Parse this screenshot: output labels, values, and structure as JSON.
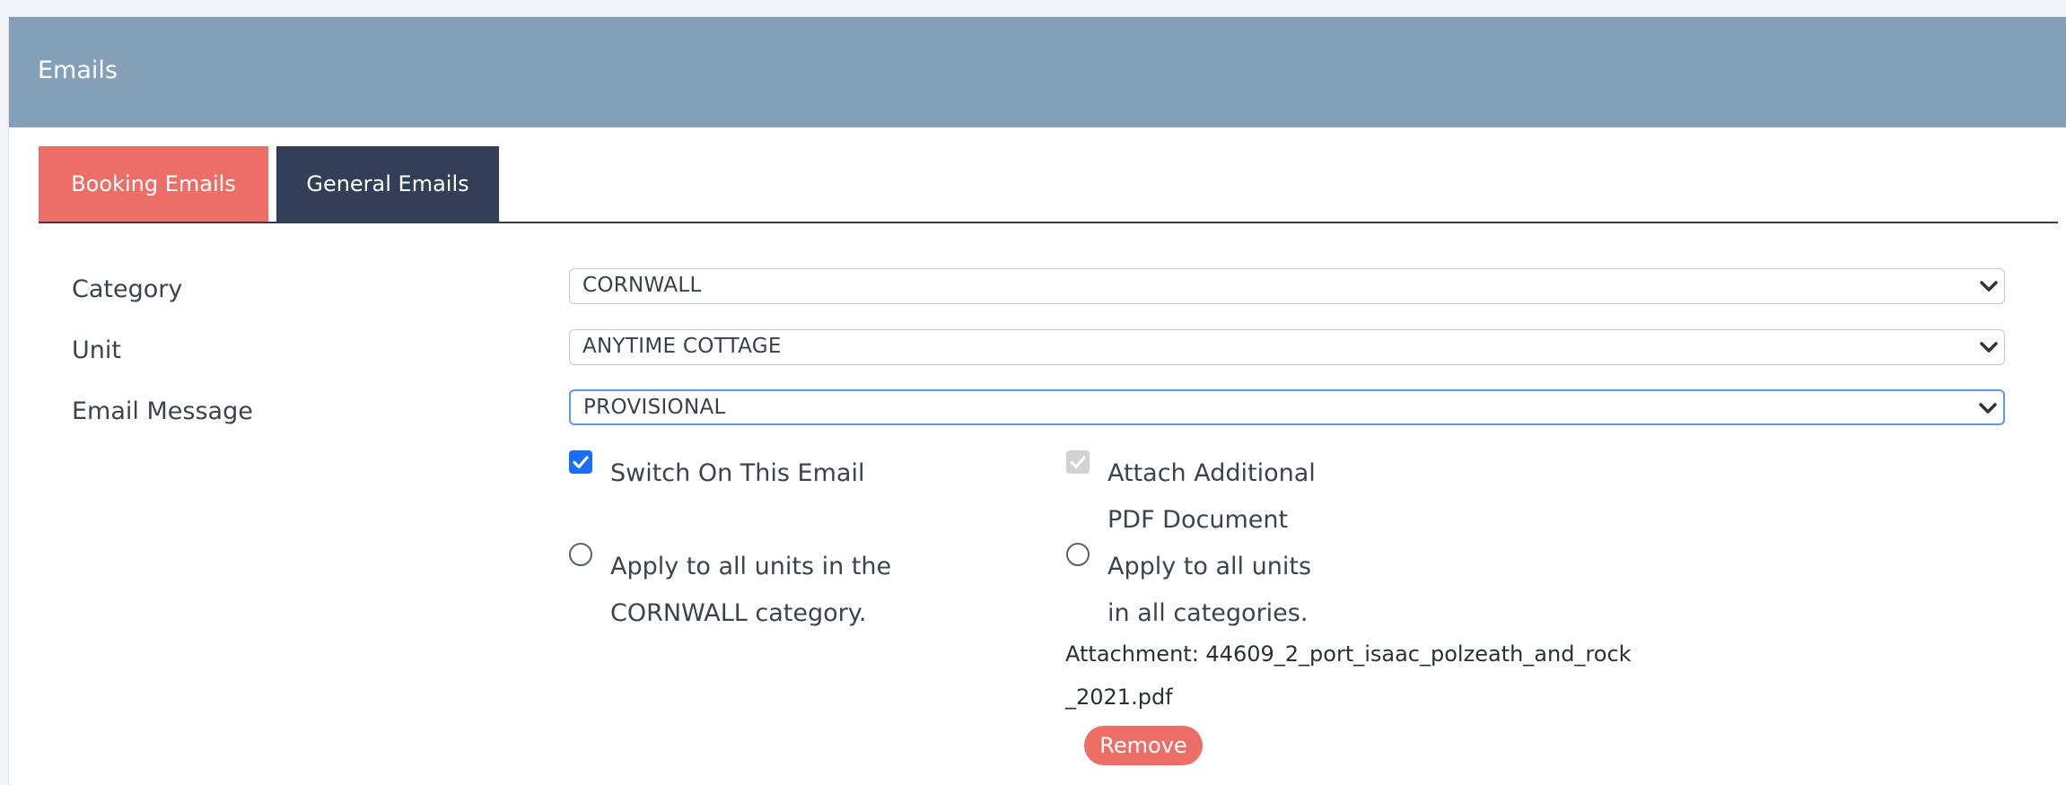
{
  "panel": {
    "title": "Emails"
  },
  "tabs": [
    {
      "label": "Booking Emails",
      "color": "#ec6e66"
    },
    {
      "label": "General Emails",
      "color": "#333f58"
    }
  ],
  "form": {
    "category": {
      "label": "Category",
      "value": "CORNWALL"
    },
    "unit": {
      "label": "Unit",
      "value": "ANYTIME COTTAGE"
    },
    "email_message": {
      "label": "Email Message",
      "value": "PROVISIONAL"
    }
  },
  "options": {
    "switch_on": {
      "label": "Switch On This Email",
      "checked": true
    },
    "attach_pdf": {
      "label_line1": "Attach Additional",
      "label_line2": "PDF Document",
      "checked": true,
      "disabled": true
    },
    "apply_category": {
      "label_line1": "Apply to all units in the",
      "label_line2": "CORNWALL category."
    },
    "apply_all": {
      "label_line1": "Apply to all units",
      "label_line2": "in all categories."
    }
  },
  "attachment": {
    "text": "Attachment: 44609_2_port_isaac_polzeath_and_rock_2021.pdf",
    "remove_label": "Remove"
  },
  "colors": {
    "header": "#84a0b8",
    "accent": "#ec6e66",
    "dark_tab": "#333f58",
    "checkbox": "#1a6ef5"
  }
}
